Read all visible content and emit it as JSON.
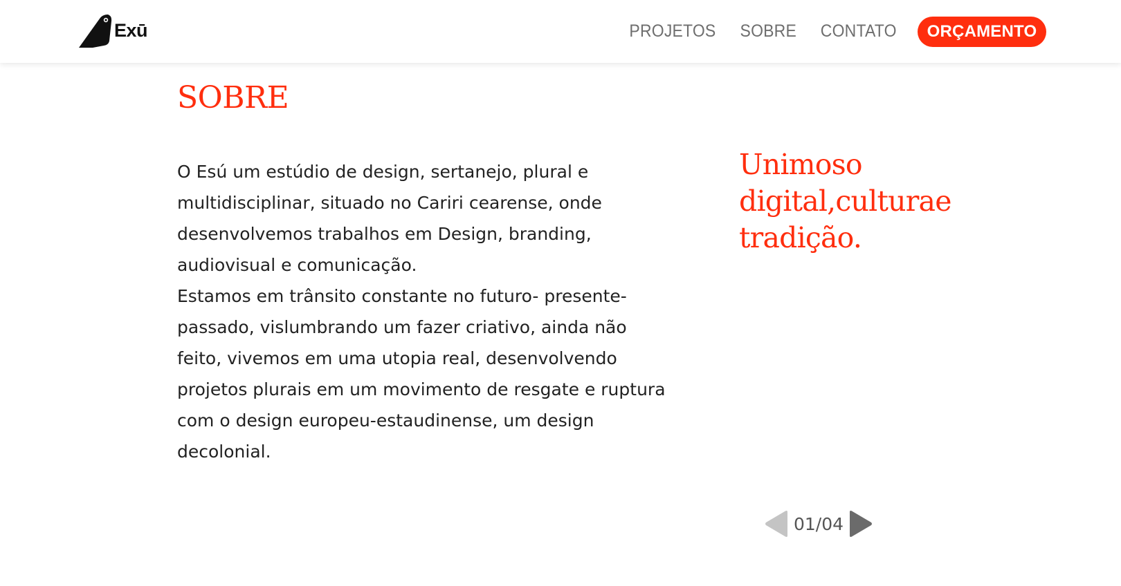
{
  "header": {
    "logo_text": "Exū",
    "nav": [
      "PROJETOS",
      "SOBRE",
      "CONTATO"
    ],
    "cta_label": "ORÇAMENTO"
  },
  "main": {
    "title": "SOBRE",
    "paragraphs": [
      "O Esú um estúdio de design, sertanejo, plural e multidisciplinar, situado no Cariri cearense, onde desenvolvemos trabalhos em Design, branding, audiovisual e comunicação.",
      "Estamos em trânsito constante no futuro- presente-passado, vislumbrando um fazer criativo, ainda não feito, vivemos em uma utopia real, desenvolvendo projetos plurais em um movimento de resgate e ruptura com o design europeu-estaudinense, um design decolonial."
    ],
    "tagline": [
      "Unimoso",
      "digital,culturae",
      "tradição."
    ]
  },
  "pager": {
    "label": "01/04",
    "prev_icon": "triangle-left-icon",
    "next_icon": "triangle-right-icon"
  },
  "colors": {
    "accent": "#ff2e0e",
    "nav_text": "#6e6e6e",
    "body_text": "#222222",
    "pager_prev_disabled": "#c4c4c4",
    "pager_next": "#6b6b6b"
  }
}
